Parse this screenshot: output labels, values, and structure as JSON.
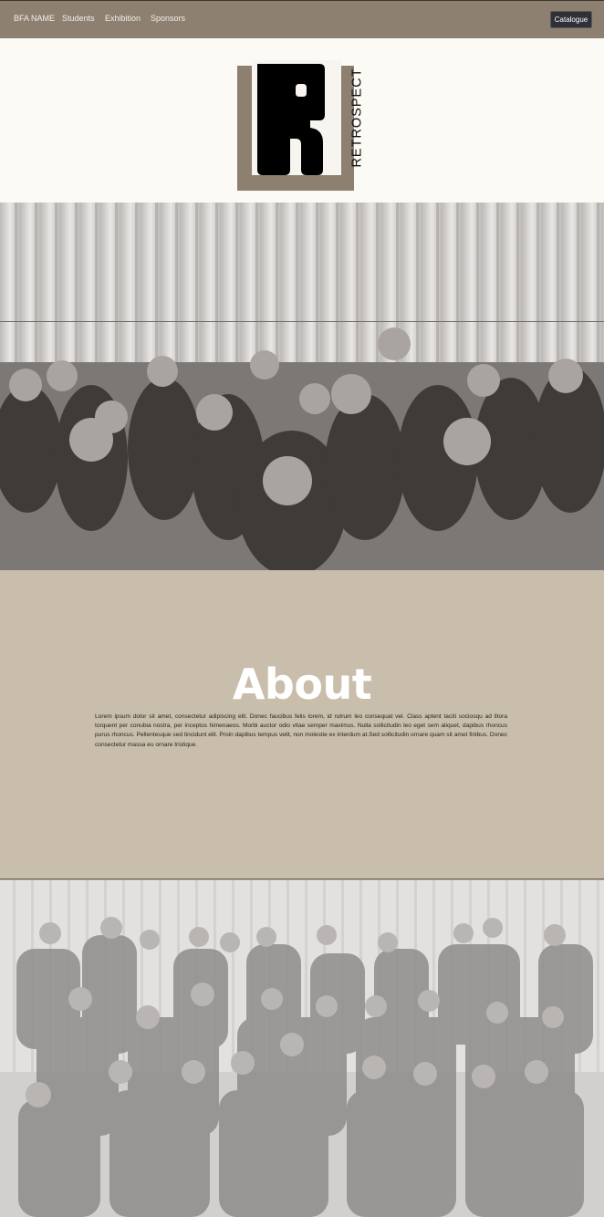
{
  "nav": {
    "brand": "BFA NAME",
    "links": [
      "Students",
      "Exhibition",
      "Sponsors"
    ],
    "catalogue_label": "Catalogue"
  },
  "logo": {
    "wordmark": "RETROSPECT"
  },
  "about": {
    "title": "About",
    "body": "Lorem ipsum dolor sit amet, consectetur adipiscing elit. Donec faucibus felis lorem, id rutrum leo consequat vel. Class aptent taciti sociosqu ad litora torquent per conubia nostra, per inceptos himenaeos. Morbi auctor odio vitae semper maximus. Nulla sollicitudin leo eget sem aliquet, dapibus rhoncus purus rhoncus. Pellentesque sed tincidunt elit. Proin dapibus tempus velit, non molestie ex interdum at.Sed sollicitudin ornare quam sit amet finibus. Donec consectetur massa eu ornare tristique."
  },
  "colors": {
    "navbar": "#8d8071",
    "about_bg": "#c9beab",
    "catalogue_button": "#2f3137",
    "logo_accent": "#8d8071"
  }
}
